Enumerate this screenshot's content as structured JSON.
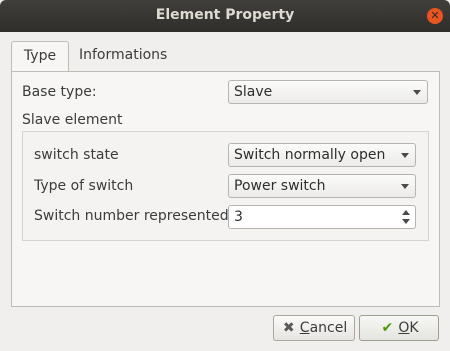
{
  "window": {
    "title": "Element Property"
  },
  "icons": {
    "close": "close-icon",
    "cancel": "cancel-x-icon",
    "ok": "ok-check-icon",
    "combo_arrow": "chevron-down-icon"
  },
  "tabs": [
    {
      "label": "Type",
      "active": true
    },
    {
      "label": "Informations",
      "active": false
    }
  ],
  "type_panel": {
    "base_type_label": "Base type:",
    "base_type_value": "Slave",
    "slave_element_label": "Slave element",
    "fields": {
      "switch_state_label": "switch state",
      "switch_state_value": "Switch normally open",
      "type_of_switch_label": "Type of switch",
      "type_of_switch_value": "Power switch",
      "switch_number_label": "Switch number represented",
      "switch_number_value": "3"
    }
  },
  "buttons": {
    "cancel_first": "C",
    "cancel_rest": "ancel",
    "ok_first": "O",
    "ok_rest": "K"
  },
  "colors": {
    "titlebar": "#3a3935",
    "close": "#e95420",
    "ok_check": "#4e9a06",
    "cancel_x": "#5a5a5a"
  }
}
